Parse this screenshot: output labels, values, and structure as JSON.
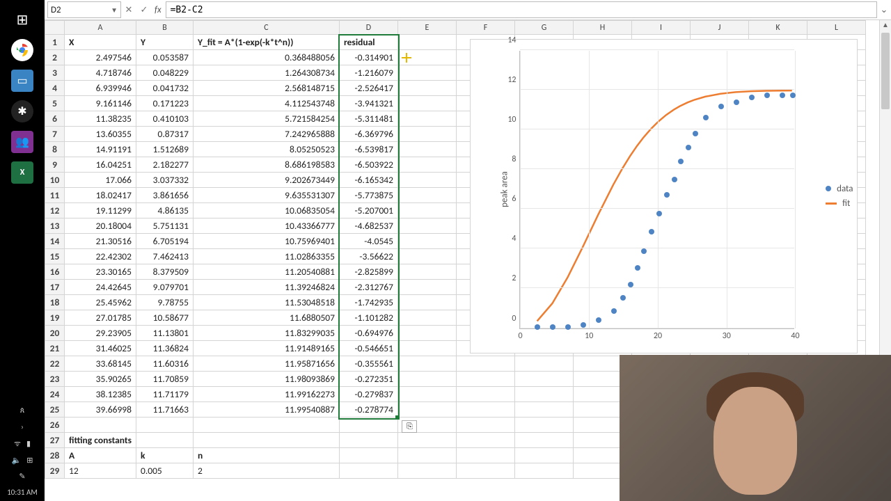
{
  "osbar": {
    "apps": [
      {
        "name": "windows-icon",
        "glyph": "⊞"
      },
      {
        "name": "chrome-icon",
        "glyph": ""
      },
      {
        "name": "files-icon",
        "glyph": "🗂"
      },
      {
        "name": "slack-icon",
        "glyph": "✱"
      },
      {
        "name": "teams-icon",
        "glyph": "👥"
      },
      {
        "name": "excel-icon",
        "glyph": "X"
      }
    ],
    "sys": {
      "people": "ጰ",
      "nav": "›",
      "wifi": "ᯤ",
      "battery": "▮",
      "vol": "🔈",
      "db": "⊞",
      "pen": "✎",
      "clock": "10:31 AM"
    }
  },
  "fxbar": {
    "name_ref": "D2",
    "fx_label": "fx",
    "formula": "=B2-C2"
  },
  "headers": [
    "A",
    "B",
    "C",
    "D",
    "E",
    "F",
    "G",
    "H",
    "I",
    "J",
    "K",
    "L"
  ],
  "row1": {
    "A": "X",
    "B": "Y",
    "C": "Y_fit = A*(1-exp(-k*t^n))",
    "D": "residual"
  },
  "data_rows": [
    {
      "r": 2,
      "A": "2.497546",
      "B": "0.053587",
      "C": "0.368488056",
      "D": "-0.314901"
    },
    {
      "r": 3,
      "A": "4.718746",
      "B": "0.048229",
      "C": "1.264308734",
      "D": "-1.216079"
    },
    {
      "r": 4,
      "A": "6.939946",
      "B": "0.041732",
      "C": "2.568148715",
      "D": "-2.526417"
    },
    {
      "r": 5,
      "A": "9.161146",
      "B": "0.171223",
      "C": "4.112543748",
      "D": "-3.941321"
    },
    {
      "r": 6,
      "A": "11.38235",
      "B": "0.410103",
      "C": "5.721584254",
      "D": "-5.311481"
    },
    {
      "r": 7,
      "A": "13.60355",
      "B": "0.87317",
      "C": "7.242965888",
      "D": "-6.369796"
    },
    {
      "r": 8,
      "A": "14.91191",
      "B": "1.512689",
      "C": "8.05250523",
      "D": "-6.539817"
    },
    {
      "r": 9,
      "A": "16.04251",
      "B": "2.182277",
      "C": "8.686198583",
      "D": "-6.503922"
    },
    {
      "r": 10,
      "A": "17.066",
      "B": "3.037332",
      "C": "9.202673449",
      "D": "-6.165342"
    },
    {
      "r": 11,
      "A": "18.02417",
      "B": "3.861656",
      "C": "9.635531307",
      "D": "-5.773875"
    },
    {
      "r": 12,
      "A": "19.11299",
      "B": "4.86135",
      "C": "10.06835054",
      "D": "-5.207001"
    },
    {
      "r": 13,
      "A": "20.18004",
      "B": "5.751131",
      "C": "10.43366777",
      "D": "-4.682537"
    },
    {
      "r": 14,
      "A": "21.30516",
      "B": "6.705194",
      "C": "10.75969401",
      "D": "-4.0545"
    },
    {
      "r": 15,
      "A": "22.42302",
      "B": "7.462413",
      "C": "11.02863355",
      "D": "-3.56622"
    },
    {
      "r": 16,
      "A": "23.30165",
      "B": "8.379509",
      "C": "11.20540881",
      "D": "-2.825899"
    },
    {
      "r": 17,
      "A": "24.42645",
      "B": "9.079701",
      "C": "11.39246824",
      "D": "-2.312767"
    },
    {
      "r": 18,
      "A": "25.45962",
      "B": "9.78755",
      "C": "11.53048518",
      "D": "-1.742935"
    },
    {
      "r": 19,
      "A": "27.01785",
      "B": "10.58677",
      "C": "11.6880507",
      "D": "-1.101282"
    },
    {
      "r": 20,
      "A": "29.23905",
      "B": "11.13801",
      "C": "11.83299035",
      "D": "-0.694976"
    },
    {
      "r": 21,
      "A": "31.46025",
      "B": "11.36824",
      "C": "11.91489165",
      "D": "-0.546651"
    },
    {
      "r": 22,
      "A": "33.68145",
      "B": "11.60316",
      "C": "11.95871656",
      "D": "-0.355561"
    },
    {
      "r": 23,
      "A": "35.90265",
      "B": "11.70859",
      "C": "11.98093869",
      "D": "-0.272351"
    },
    {
      "r": 24,
      "A": "38.12385",
      "B": "11.71179",
      "C": "11.99162273",
      "D": "-0.279837"
    },
    {
      "r": 25,
      "A": "39.66998",
      "B": "11.71663",
      "C": "11.99540887",
      "D": "-0.278774"
    }
  ],
  "extra_rows": [
    {
      "r": 26
    },
    {
      "r": 27,
      "A": "fitting constants",
      "bold": true
    },
    {
      "r": 28,
      "A": "A",
      "B": "k",
      "C": "n",
      "bold": true
    },
    {
      "r": 29,
      "A": "12",
      "B": "0.005",
      "C": "2"
    }
  ],
  "chart_data": {
    "type": "scatter+line",
    "ylabel": "peak area",
    "xlim": [
      0,
      40
    ],
    "ylim": [
      0,
      14
    ],
    "yticks": [
      0,
      2,
      4,
      6,
      8,
      10,
      12,
      14
    ],
    "xticks": [
      0,
      10,
      20,
      30,
      40
    ],
    "series": [
      {
        "name": "data",
        "kind": "scatter",
        "color": "#4e84c4",
        "x": [
          2.497546,
          4.718746,
          6.939946,
          9.161146,
          11.38235,
          13.60355,
          14.91191,
          16.04251,
          17.066,
          18.02417,
          19.11299,
          20.18004,
          21.30516,
          22.42302,
          23.30165,
          24.42645,
          25.45962,
          27.01785,
          29.23905,
          31.46025,
          33.68145,
          35.90265,
          38.12385,
          39.66998
        ],
        "y": [
          0.053587,
          0.048229,
          0.041732,
          0.171223,
          0.410103,
          0.87317,
          1.512689,
          2.182277,
          3.037332,
          3.861656,
          4.86135,
          5.751131,
          6.705194,
          7.462413,
          8.379509,
          9.079701,
          9.78755,
          10.58677,
          11.13801,
          11.36824,
          11.60316,
          11.70859,
          11.71179,
          11.71663
        ]
      },
      {
        "name": "fit",
        "kind": "line",
        "color": "#ed7d31",
        "x": [
          2.497546,
          4.718746,
          6.939946,
          9.161146,
          11.38235,
          13.60355,
          14.91191,
          16.04251,
          17.066,
          18.02417,
          19.11299,
          20.18004,
          21.30516,
          22.42302,
          23.30165,
          24.42645,
          25.45962,
          27.01785,
          29.23905,
          31.46025,
          33.68145,
          35.90265,
          38.12385,
          39.66998
        ],
        "y": [
          0.368488056,
          1.264308734,
          2.568148715,
          4.112543748,
          5.721584254,
          7.242965888,
          8.05250523,
          8.686198583,
          9.202673449,
          9.635531307,
          10.06835054,
          10.43366777,
          10.75969401,
          11.02863355,
          11.20540881,
          11.39246824,
          11.53048518,
          11.6880507,
          11.83299035,
          11.91489165,
          11.95871656,
          11.98093869,
          11.99162273,
          11.99540887
        ]
      }
    ],
    "legend": [
      "data",
      "fit"
    ]
  },
  "autofill_icon": "⎘"
}
